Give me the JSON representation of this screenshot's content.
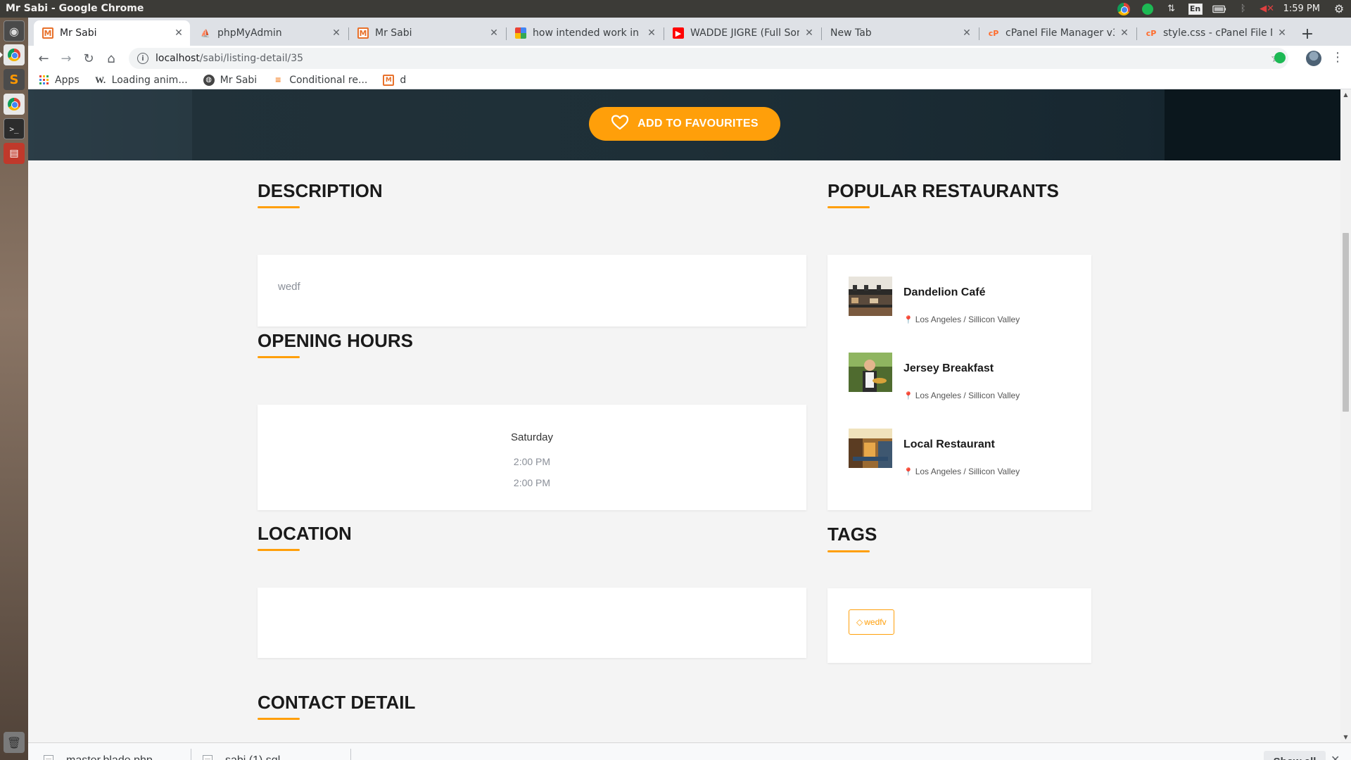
{
  "os": {
    "window_title": "Mr Sabi - Google Chrome",
    "clock": "1:59 PM",
    "keyboard_lang": "En"
  },
  "browser": {
    "tabs": [
      {
        "label": "Mr Sabi",
        "icon": "mr-sabi-favicon",
        "active": true
      },
      {
        "label": "phpMyAdmin",
        "icon": "phpmyadmin-favicon"
      },
      {
        "label": "Mr Sabi",
        "icon": "mr-sabi-favicon"
      },
      {
        "label": "how intended work in l",
        "icon": "google-favicon"
      },
      {
        "label": "WADDE JIGRE (Full Son",
        "icon": "youtube-favicon"
      },
      {
        "label": "New Tab",
        "icon": ""
      },
      {
        "label": "cPanel File Manager v3",
        "icon": "cpanel-favicon"
      },
      {
        "label": "style.css - cPanel File M",
        "icon": "cpanel-favicon"
      }
    ],
    "url_host": "localhost",
    "url_path": "/sabi/listing-detail/35",
    "bookmarks": [
      {
        "label": "Apps",
        "icon": "apps-grid-icon"
      },
      {
        "label": "Loading anim...",
        "icon": "w-icon"
      },
      {
        "label": "Mr Sabi",
        "icon": "globe-icon"
      },
      {
        "label": "Conditional re...",
        "icon": "stackoverflow-icon"
      },
      {
        "label": "d",
        "icon": "mr-sabi-favicon"
      }
    ]
  },
  "page": {
    "favourite_button": "ADD TO FAVOURITES",
    "description": {
      "title": "DESCRIPTION",
      "text": "wedf"
    },
    "opening_hours": {
      "title": "OPENING HOURS",
      "day": "Saturday",
      "open": "2:00 PM",
      "close": "2:00 PM"
    },
    "location": {
      "title": "LOCATION"
    },
    "contact": {
      "title": "CONTACT DETAIL"
    },
    "popular": {
      "title": "POPULAR RESTAURANTS",
      "items": [
        {
          "name": "Dandelion Café",
          "location": "Los Angeles / Sillicon Valley"
        },
        {
          "name": "Jersey Breakfast",
          "location": "Los Angeles / Sillicon Valley"
        },
        {
          "name": "Local Restaurant",
          "location": "Los Angeles / Sillicon Valley"
        }
      ]
    },
    "tags": {
      "title": "TAGS",
      "items": [
        "wedfv"
      ]
    }
  },
  "downloads": {
    "items": [
      "master.blade.php",
      "sabi (1).sql"
    ],
    "show_all": "Show all"
  },
  "colors": {
    "accent": "#ff9f0a",
    "hero_bg": "#1e2f37",
    "page_bg": "#f4f4f4"
  }
}
